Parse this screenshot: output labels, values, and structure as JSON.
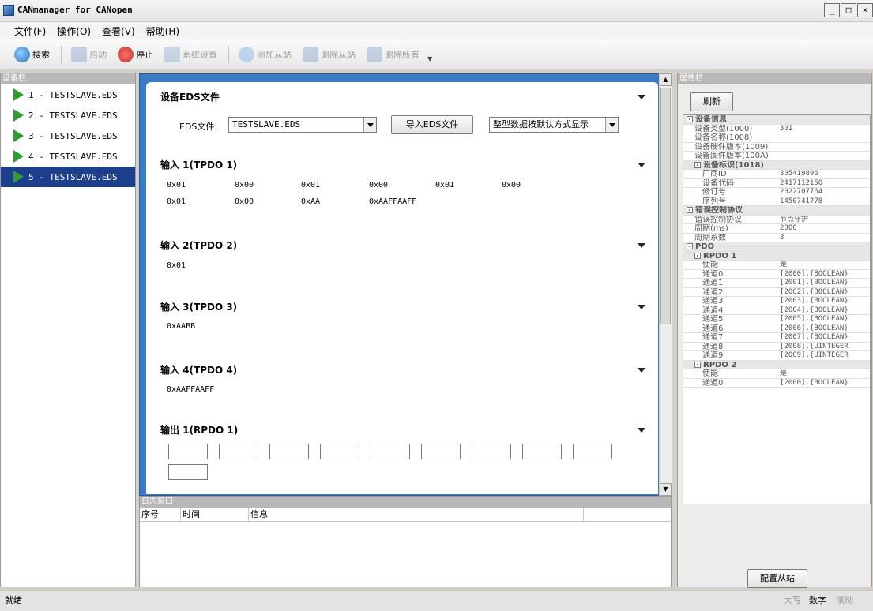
{
  "window": {
    "title": "CANmanager for CANopen",
    "min": "_",
    "max": "□",
    "close": "×"
  },
  "menu": [
    "文件(F)",
    "操作(O)",
    "查看(V)",
    "帮助(H)"
  ],
  "toolbar": {
    "search": "搜索",
    "start": "启动",
    "stop": "停止",
    "settings": "系统设置",
    "add_slave": "添加从站",
    "remove_slave": "删除从站",
    "remove_all": "删除所有"
  },
  "device_panel": {
    "title": "设备栏",
    "items": [
      "1 - TESTSLAVE.EDS",
      "2 - TESTSLAVE.EDS",
      "3 - TESTSLAVE.EDS",
      "4 - TESTSLAVE.EDS",
      "5 - TESTSLAVE.EDS"
    ]
  },
  "eds": {
    "section_title": "设备EDS文件",
    "file_label": "EDS文件:",
    "file_value": "TESTSLAVE.EDS",
    "import_button": "导入EDS文件",
    "display_mode": "整型数据按默认方式显示"
  },
  "pdo_sections": [
    {
      "title": "输入 1(TPDO 1)",
      "rows": [
        [
          "0x01",
          "0x00",
          "0x01",
          "0x00",
          "0x01",
          "0x00"
        ],
        [
          "0x01",
          "0x00",
          "0xAA",
          "0xAAFFAAFF"
        ]
      ]
    },
    {
      "title": "输入 2(TPDO 2)",
      "rows": [
        [
          "0x01"
        ]
      ]
    },
    {
      "title": "输入 3(TPDO 3)",
      "rows": [
        [
          "0xAABB"
        ]
      ]
    },
    {
      "title": "输入 4(TPDO 4)",
      "rows": [
        [
          "0xAAFFAAFF"
        ]
      ]
    },
    {
      "title": "输出 1(RPDO 1)",
      "rows": []
    }
  ],
  "log": {
    "title": "日志窗口",
    "cols": [
      "序号",
      "时间",
      "信息"
    ]
  },
  "props": {
    "title": "属性栏",
    "refresh": "刷新",
    "configure": "配置从站",
    "rows": [
      {
        "k": "设备信息",
        "cat": true,
        "lvl": 0
      },
      {
        "k": "设备类型(1000)",
        "v": "301",
        "lvl": 1
      },
      {
        "k": "设备名称(1008)",
        "v": "",
        "lvl": 1
      },
      {
        "k": "设备硬件版本(1009)",
        "v": "",
        "lvl": 1
      },
      {
        "k": "设备固件版本(100A)",
        "v": "",
        "lvl": 1
      },
      {
        "k": "设备标识(1018)",
        "cat": true,
        "lvl": 1
      },
      {
        "k": "厂商ID",
        "v": "305419896",
        "lvl": 2
      },
      {
        "k": "设备代码",
        "v": "2417112150",
        "lvl": 2
      },
      {
        "k": "修订号",
        "v": "2022707764",
        "lvl": 2
      },
      {
        "k": "序列号",
        "v": "1450741778",
        "lvl": 2
      },
      {
        "k": "错误控制协议",
        "cat": true,
        "lvl": 0
      },
      {
        "k": "错误控制协议",
        "v": "节点守护",
        "lvl": 1
      },
      {
        "k": "周期(ms)",
        "v": "2000",
        "lvl": 1
      },
      {
        "k": "周期系数",
        "v": "3",
        "lvl": 1
      },
      {
        "k": "PDO",
        "cat": true,
        "lvl": 0
      },
      {
        "k": "RPDO 1",
        "cat": true,
        "lvl": 1
      },
      {
        "k": "使能",
        "v": "是",
        "lvl": 2
      },
      {
        "k": "通道0",
        "v": "[2000].{BOOLEAN}",
        "lvl": 2
      },
      {
        "k": "通道1",
        "v": "[2001].{BOOLEAN}",
        "lvl": 2
      },
      {
        "k": "通道2",
        "v": "[2002].{BOOLEAN}",
        "lvl": 2
      },
      {
        "k": "通道3",
        "v": "[2003].{BOOLEAN}",
        "lvl": 2
      },
      {
        "k": "通道4",
        "v": "[2004].{BOOLEAN}",
        "lvl": 2
      },
      {
        "k": "通道5",
        "v": "[2005].{BOOLEAN}",
        "lvl": 2
      },
      {
        "k": "通道6",
        "v": "[2006].{BOOLEAN}",
        "lvl": 2
      },
      {
        "k": "通道7",
        "v": "[2007].{BOOLEAN}",
        "lvl": 2
      },
      {
        "k": "通道8",
        "v": "[2008].{UINTEGER",
        "lvl": 2
      },
      {
        "k": "通道9",
        "v": "[2009].{UINTEGER",
        "lvl": 2
      },
      {
        "k": "RPDO 2",
        "cat": true,
        "lvl": 1
      },
      {
        "k": "使能",
        "v": "是",
        "lvl": 2
      },
      {
        "k": "通道0",
        "v": "[2000].{BOOLEAN}",
        "lvl": 2
      }
    ]
  },
  "status": {
    "text": "就绪",
    "caps": "大写",
    "num": "数字",
    "scroll": "滚动"
  }
}
